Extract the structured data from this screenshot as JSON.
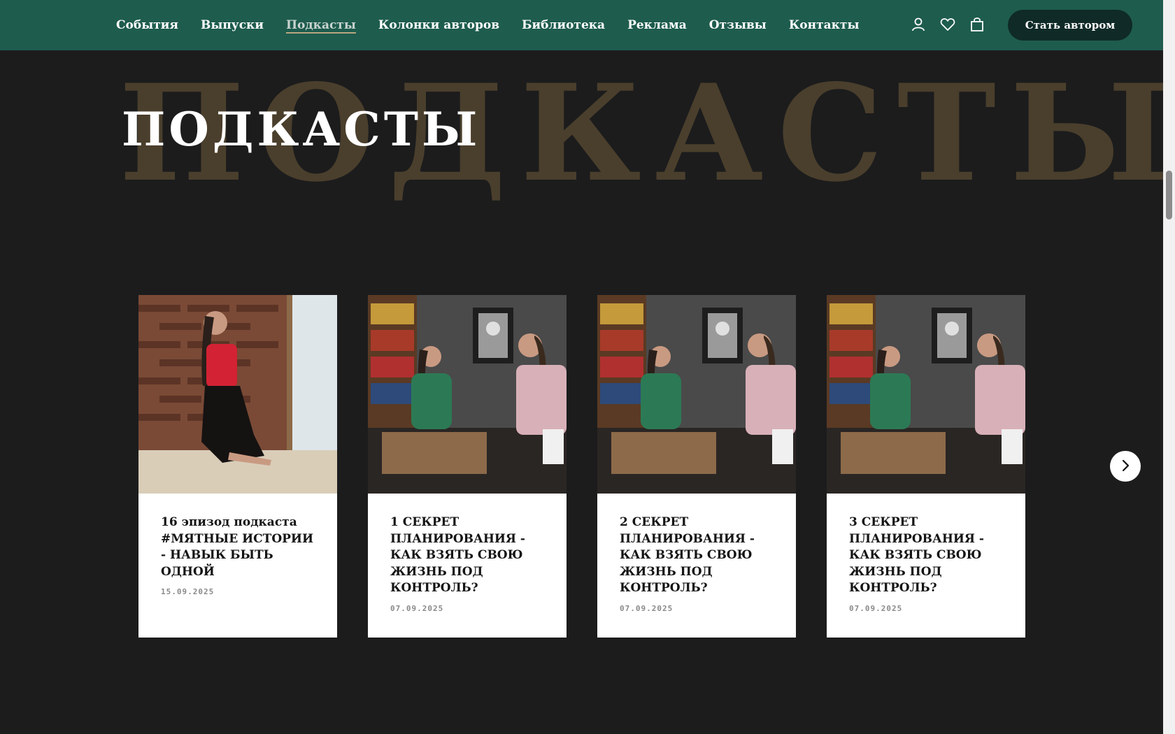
{
  "nav": {
    "items": [
      "События",
      "Выпуски",
      "Подкасты",
      "Колонки авторов",
      "Библиотека",
      "Реклама",
      "Отзывы",
      "Контакты"
    ],
    "active_index": 2
  },
  "header_icons": [
    "user-icon",
    "heart-icon",
    "cart-icon"
  ],
  "cta_label": "Стать автором",
  "hero": {
    "background_word": "ПОДКАСТЫ",
    "title": "ПОДКАСТЫ"
  },
  "cards": [
    {
      "title": "16 эпизод подкаста #МЯТНЫЕ ИСТОРИИ - НАВЫК БЫТЬ ОДНОЙ",
      "date": "15.09.2025",
      "image": "woman-sitting-by-window-photo"
    },
    {
      "title": "1 СЕКРЕТ ПЛАНИРОВАНИЯ - КАК ВЗЯТЬ СВОЮ ЖИЗНЬ ПОД КОНТРОЛЬ?",
      "date": "07.09.2025",
      "image": "two-women-talking-photo"
    },
    {
      "title": "2 СЕКРЕТ ПЛАНИРОВАНИЯ - КАК ВЗЯТЬ СВОЮ ЖИЗНЬ ПОД КОНТРОЛЬ?",
      "date": "07.09.2025",
      "image": "two-women-talking-photo"
    },
    {
      "title": "3 СЕКРЕТ ПЛАНИРОВАНИЯ - КАК ВЗЯТЬ СВОЮ ЖИЗНЬ ПОД КОНТРОЛЬ?",
      "date": "07.09.2025",
      "image": "two-women-talking-photo"
    }
  ],
  "carousel_next_icon": "chevron-right-icon",
  "colors": {
    "header_bg": "#1e5c4e",
    "page_bg": "#1c1c1d",
    "cta_bg": "#0f2a27",
    "bg_word": "#4a3f2c",
    "active_underline": "#b9a77f"
  }
}
